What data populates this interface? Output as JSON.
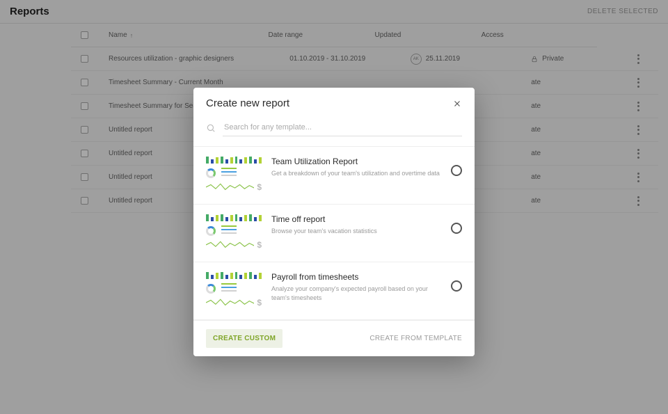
{
  "header": {
    "title": "Reports",
    "delete_selected": "DELETE SELECTED"
  },
  "table": {
    "columns": {
      "name": "Name",
      "date_range": "Date range",
      "updated": "Updated",
      "access": "Access"
    },
    "rows": [
      {
        "name": "Resources utilization - graphic designers",
        "date_range": "01.10.2019 - 31.10.2019",
        "updated": "25.11.2019",
        "updated_avatar": "AK",
        "access": "Private",
        "access_icon": "lock"
      },
      {
        "name": "Timesheet Summary - Current Month",
        "date_range": "",
        "updated": "",
        "access": "ate"
      },
      {
        "name": "Timesheet Summary for Sea Hotels b",
        "date_range": "",
        "updated": "",
        "access": "ate"
      },
      {
        "name": "Untitled report",
        "date_range": "",
        "updated": "",
        "access": "ate"
      },
      {
        "name": "Untitled report",
        "date_range": "",
        "updated": "",
        "access": "ate"
      },
      {
        "name": "Untitled report",
        "date_range": "",
        "updated": "",
        "access": "ate"
      },
      {
        "name": "Untitled report",
        "date_range": "",
        "updated": "",
        "access": "ate"
      }
    ]
  },
  "modal": {
    "title": "Create new report",
    "search_placeholder": "Search for any template...",
    "templates": [
      {
        "title": "Team Utilization Report",
        "desc": "Get a breakdown of your team's utilization and overtime data"
      },
      {
        "title": "Time off report",
        "desc": "Browse your team's vacation statistics"
      },
      {
        "title": "Payroll from timesheets",
        "desc": "Analyze your company's expected payroll based on your team's timesheets"
      }
    ],
    "create_custom": "CREATE CUSTOM",
    "create_from_template": "CREATE FROM TEMPLATE"
  }
}
